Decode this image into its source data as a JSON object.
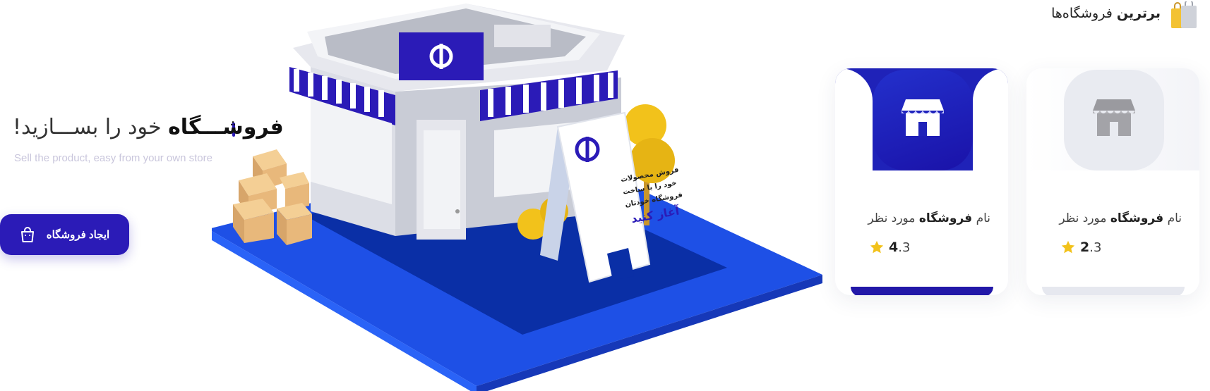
{
  "section": {
    "title_bold": "برترین",
    "title_rest": "فروشگاه‌ها",
    "icon": "shopping-bags-icon"
  },
  "stores": [
    {
      "name_prefix": "نام",
      "name_bold": "فروشگاه",
      "name_suffix": "مورد نظر",
      "rating_main": "2",
      "rating_decimal": ".3",
      "rating_value": 2.3,
      "icon": "storefront-icon",
      "accent": "#e9ebf1",
      "icon_color": "#9a9a9f"
    },
    {
      "name_prefix": "نام",
      "name_bold": "فروشگاه",
      "name_suffix": "مورد نظر",
      "rating_main": "4",
      "rating_decimal": ".3",
      "rating_value": 4.3,
      "icon": "storefront-icon",
      "accent": "#1f22b8",
      "icon_color": "#ffffff"
    }
  ],
  "hero": {
    "title_bold": "فروشـــگاه",
    "title_rest": "خود را بســـازید!",
    "subtitle": "Sell the product, easy from your own store",
    "cta_label": "ایجاد فروشگاه",
    "cta_icon": "shopping-bag-icon"
  },
  "illustration": {
    "sign_line1": "فروش محصولات",
    "sign_line2": "خود را با ساخت",
    "sign_line3": "فروشگاه خودتان",
    "sign_line4": "آغاز کنید"
  },
  "colors": {
    "brand": "#2b1bb7",
    "star": "#f2c21b",
    "platform": "#1b4fe0"
  }
}
